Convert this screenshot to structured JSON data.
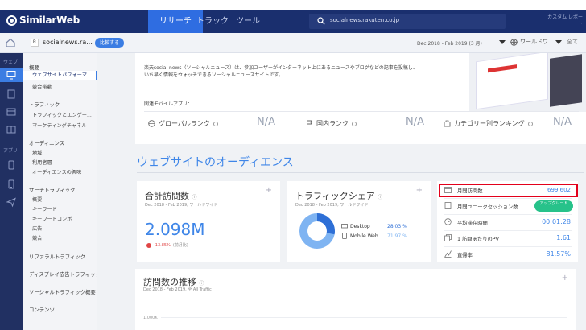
{
  "brand": {
    "name": "SimilarWeb"
  },
  "top_nav": {
    "tabs": [
      "リサーチ",
      "トラック",
      "ツール"
    ],
    "active_index": 0,
    "search_value": "socialnews.rakuten.co.jp",
    "top_right": "カスタム レポート"
  },
  "subbar": {
    "site_name": "socialnews.ra...",
    "compare_label": "比較する",
    "date_range": "Dec 2018 - Feb 2019 (3 月)",
    "region": "ワールドワ...",
    "region_extra": "全て"
  },
  "rail": {
    "labels": [
      "ウェブ",
      "アプリ"
    ]
  },
  "sidebar": {
    "items": [
      {
        "label": "概要",
        "type": "section"
      },
      {
        "label": "ウェブサイトパフォーマ...",
        "type": "active"
      },
      {
        "label": "競合帯動",
        "type": "sub"
      },
      {
        "label": "トラフィック",
        "type": "section"
      },
      {
        "label": "トラフィックとエンゲー...",
        "type": "sub"
      },
      {
        "label": "マーケティングチャネル",
        "type": "sub"
      },
      {
        "label": "オーディエンス",
        "type": "section"
      },
      {
        "label": "地域",
        "type": "sub"
      },
      {
        "label": "利用者層",
        "type": "sub"
      },
      {
        "label": "オーディエンスの興味",
        "type": "sub"
      },
      {
        "label": "サーチトラフィック",
        "type": "section"
      },
      {
        "label": "概要",
        "type": "sub"
      },
      {
        "label": "キーワード",
        "type": "sub"
      },
      {
        "label": "キーワードコンボ",
        "type": "sub"
      },
      {
        "label": "広告",
        "type": "sub"
      },
      {
        "label": "競合",
        "type": "sub"
      },
      {
        "label": "リファラルトラフィック",
        "type": "section"
      },
      {
        "label": "ディスプレイ広告トラフィック",
        "type": "section"
      },
      {
        "label": "ソーシャルトラフィック概要",
        "type": "section"
      },
      {
        "label": "コンテンツ",
        "type": "section"
      }
    ]
  },
  "intro": {
    "description": "楽天social news（ソーシャルニュース）は、参加ユーザーがインターネット上にあるニュースやブログなどの記事を投稿し、いち早く情報をウォッチできるソーシャルニュースサイトです。",
    "related_apps": "関連モバイルアプリ：",
    "ranks": [
      {
        "label": "グローバルランク",
        "value": "N/A"
      },
      {
        "label": "国内ランク",
        "value": "N/A"
      },
      {
        "label": "カテゴリー別ランキング",
        "value": "N/A"
      }
    ]
  },
  "audience": {
    "section_title": "ウェブサイトのオーディエンス",
    "total_visits": {
      "title": "合計訪問数",
      "sub": "Dec 2018 - Feb 2019, ワールドワイド",
      "value": "2.098M",
      "delta": "-13.85%",
      "delta_note": "(前月比)"
    },
    "traffic_share": {
      "title": "トラフィックシェア",
      "sub": "Dec 2018 - Feb 2019, ワールドワイド",
      "desktop_label": "Desktop",
      "desktop_value": "28.03 %",
      "mobile_label": "Mobile Web",
      "mobile_value": "71.97 %",
      "desktop_fraction": 0.2803
    },
    "metrics": [
      {
        "label": "月間訪問数",
        "value": "699,602"
      },
      {
        "label": "月間ユニークセッション数",
        "value": "",
        "upgrade": "アップグレード"
      },
      {
        "label": "平均滞在時間",
        "value": "00:01:28"
      },
      {
        "label": "1 訪問あたりのPV",
        "value": "1.61"
      },
      {
        "label": "直帰率",
        "value": "81.57%"
      }
    ]
  },
  "trend": {
    "title": "訪問数の推移",
    "sub": "Dec 2018 - Feb 2019, 全 All Traffic",
    "ytick": "1,000K"
  },
  "colors": {
    "accent": "#3f86e8",
    "navy": "#1a2f6e",
    "highlight": "#e3001b",
    "upgrade": "#27c28a"
  }
}
